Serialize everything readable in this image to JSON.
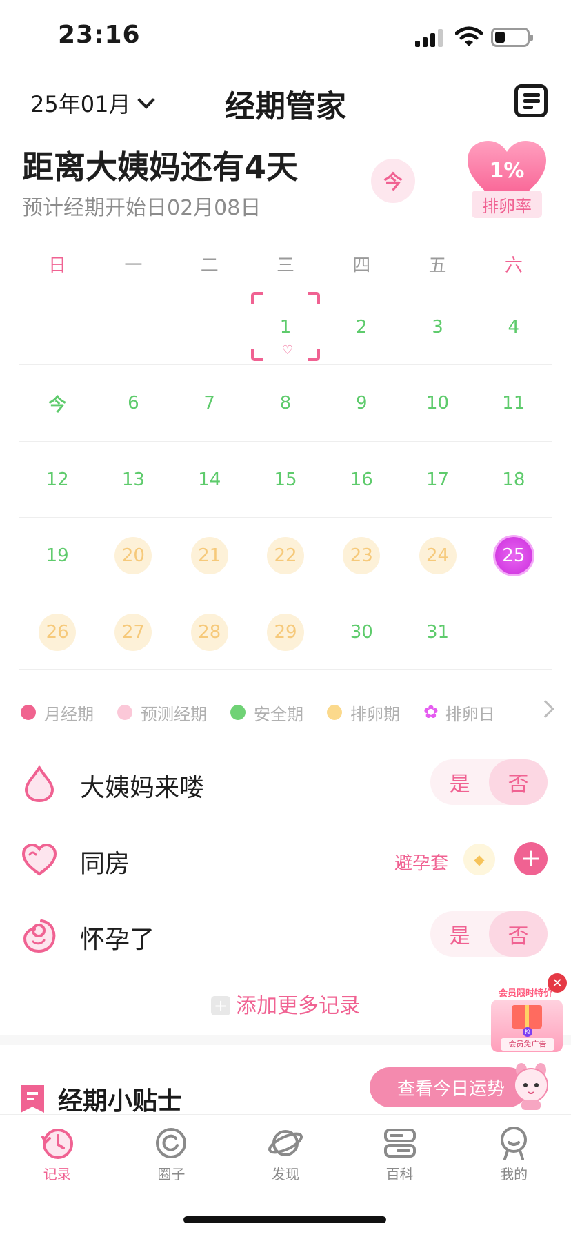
{
  "status_bar": {
    "time": "23:16"
  },
  "header": {
    "month": "25年01月",
    "title": "经期管家"
  },
  "summary": {
    "countdown": "距离大姨妈还有4天",
    "predicted_start": "预计经期开始日02月08日",
    "today_button": "今",
    "ovulation_rate": "1%",
    "ovulation_rate_label": "排卵率"
  },
  "calendar": {
    "weekdays": [
      "日",
      "一",
      "二",
      "三",
      "四",
      "五",
      "六"
    ],
    "weeks": [
      [
        {
          "label": "",
          "type": "empty"
        },
        {
          "label": "",
          "type": "empty"
        },
        {
          "label": "",
          "type": "empty"
        },
        {
          "label": "1",
          "type": "selected"
        },
        {
          "label": "2",
          "type": "safe"
        },
        {
          "label": "3",
          "type": "safe"
        },
        {
          "label": "4",
          "type": "safe"
        }
      ],
      [
        {
          "label": "今",
          "type": "today"
        },
        {
          "label": "6",
          "type": "safe"
        },
        {
          "label": "7",
          "type": "safe"
        },
        {
          "label": "8",
          "type": "safe"
        },
        {
          "label": "9",
          "type": "safe"
        },
        {
          "label": "10",
          "type": "safe"
        },
        {
          "label": "11",
          "type": "safe"
        }
      ],
      [
        {
          "label": "12",
          "type": "safe"
        },
        {
          "label": "13",
          "type": "safe"
        },
        {
          "label": "14",
          "type": "safe"
        },
        {
          "label": "15",
          "type": "safe"
        },
        {
          "label": "16",
          "type": "safe"
        },
        {
          "label": "17",
          "type": "safe"
        },
        {
          "label": "18",
          "type": "safe"
        }
      ],
      [
        {
          "label": "19",
          "type": "safe"
        },
        {
          "label": "20",
          "type": "ovulation-period"
        },
        {
          "label": "21",
          "type": "ovulation-period"
        },
        {
          "label": "22",
          "type": "ovulation-period"
        },
        {
          "label": "23",
          "type": "ovulation-period"
        },
        {
          "label": "24",
          "type": "ovulation-period"
        },
        {
          "label": "25",
          "type": "ovulation-day"
        }
      ],
      [
        {
          "label": "26",
          "type": "ovulation-period"
        },
        {
          "label": "27",
          "type": "ovulation-period"
        },
        {
          "label": "28",
          "type": "ovulation-period"
        },
        {
          "label": "29",
          "type": "ovulation-period"
        },
        {
          "label": "30",
          "type": "safe"
        },
        {
          "label": "31",
          "type": "safe"
        },
        {
          "label": "",
          "type": "empty"
        }
      ]
    ]
  },
  "legend": [
    {
      "label": "月经期",
      "color": "#f0638f"
    },
    {
      "label": "预测经期",
      "color": "#fbc8d8"
    },
    {
      "label": "安全期",
      "color": "#6fd275"
    },
    {
      "label": "排卵期",
      "color": "#fbd98c"
    },
    {
      "label": "排卵日",
      "color": "#e55cf0"
    }
  ],
  "records": {
    "period": {
      "label": "大姨妈来喽",
      "yes": "是",
      "no": "否"
    },
    "intimacy": {
      "label": "同房",
      "method": "避孕套"
    },
    "pregnant": {
      "label": "怀孕了",
      "yes": "是",
      "no": "否"
    },
    "add_more": "添加更多记录"
  },
  "tips": {
    "title": "经期小贴士",
    "fortune_button": "查看今日运势"
  },
  "promo": {
    "banner": "会员限时特价",
    "grab": "抢",
    "label": "会员免广告",
    "close": "✕"
  },
  "tabs": [
    {
      "label": "记录",
      "icon": "record-clock-icon"
    },
    {
      "label": "圈子",
      "icon": "circle-icon"
    },
    {
      "label": "发现",
      "icon": "planet-icon"
    },
    {
      "label": "百科",
      "icon": "encyclopedia-icon"
    },
    {
      "label": "我的",
      "icon": "profile-icon"
    }
  ],
  "colors": {
    "accent": "#f06292",
    "safe": "#5ecb6c",
    "ovulation_period": "#fdf1d8",
    "ovulation_day": "#d43ee3"
  }
}
